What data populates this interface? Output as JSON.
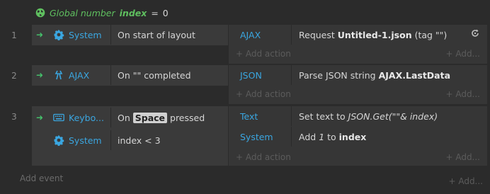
{
  "global_var": {
    "prefix": "Global number",
    "name": "index",
    "eq": "=",
    "value": "0"
  },
  "events": [
    {
      "number": "1",
      "conditions": [
        {
          "object": "System",
          "icon": "gear-icon",
          "text": "On start of layout"
        }
      ],
      "actions": [
        {
          "object": "AJAX",
          "icon": "ajax-icon",
          "text_plain": "Request ",
          "text_bold": "Untitled-1.json",
          "text_tail": " (tag \"\")"
        }
      ],
      "add_action": "+ Add action",
      "add_right": "+ Add..."
    },
    {
      "number": "2",
      "conditions": [
        {
          "object": "AJAX",
          "icon": "ajax-icon",
          "text": "On \"\" completed"
        }
      ],
      "actions": [
        {
          "object": "JSON",
          "icon": "json-icon",
          "text_plain": "Parse JSON string ",
          "text_bold": "AJAX.LastData",
          "text_tail": ""
        }
      ],
      "add_action": "+ Add action",
      "add_right": "+ Add..."
    },
    {
      "number": "3",
      "conditions": [
        {
          "object": "Keybo...",
          "icon": "keyboard-icon",
          "text_pre": "On ",
          "text_key": "Space",
          "text_post": " pressed"
        },
        {
          "object": "System",
          "icon": "gear-icon",
          "text": "index < 3"
        }
      ],
      "actions": [
        {
          "object": "Text",
          "icon": "text-object-icon",
          "text_plain": "Set text to ",
          "text_italic": "JSON.Get(\"\"& index)"
        },
        {
          "object": "System",
          "icon": "gear-icon",
          "text_plain": "Add ",
          "text_italic": "1",
          "text_mid": " to ",
          "text_bold": "index"
        }
      ],
      "add_action": "+ Add action",
      "add_right": "+ Add..."
    }
  ],
  "add_event": "Add event",
  "add_event_right": "+ Add...",
  "colors": {
    "background": "#2b2b2b",
    "object_blue": "#3aa6e0",
    "trigger_green": "#45c06b",
    "global_green": "#5fbf5f"
  }
}
